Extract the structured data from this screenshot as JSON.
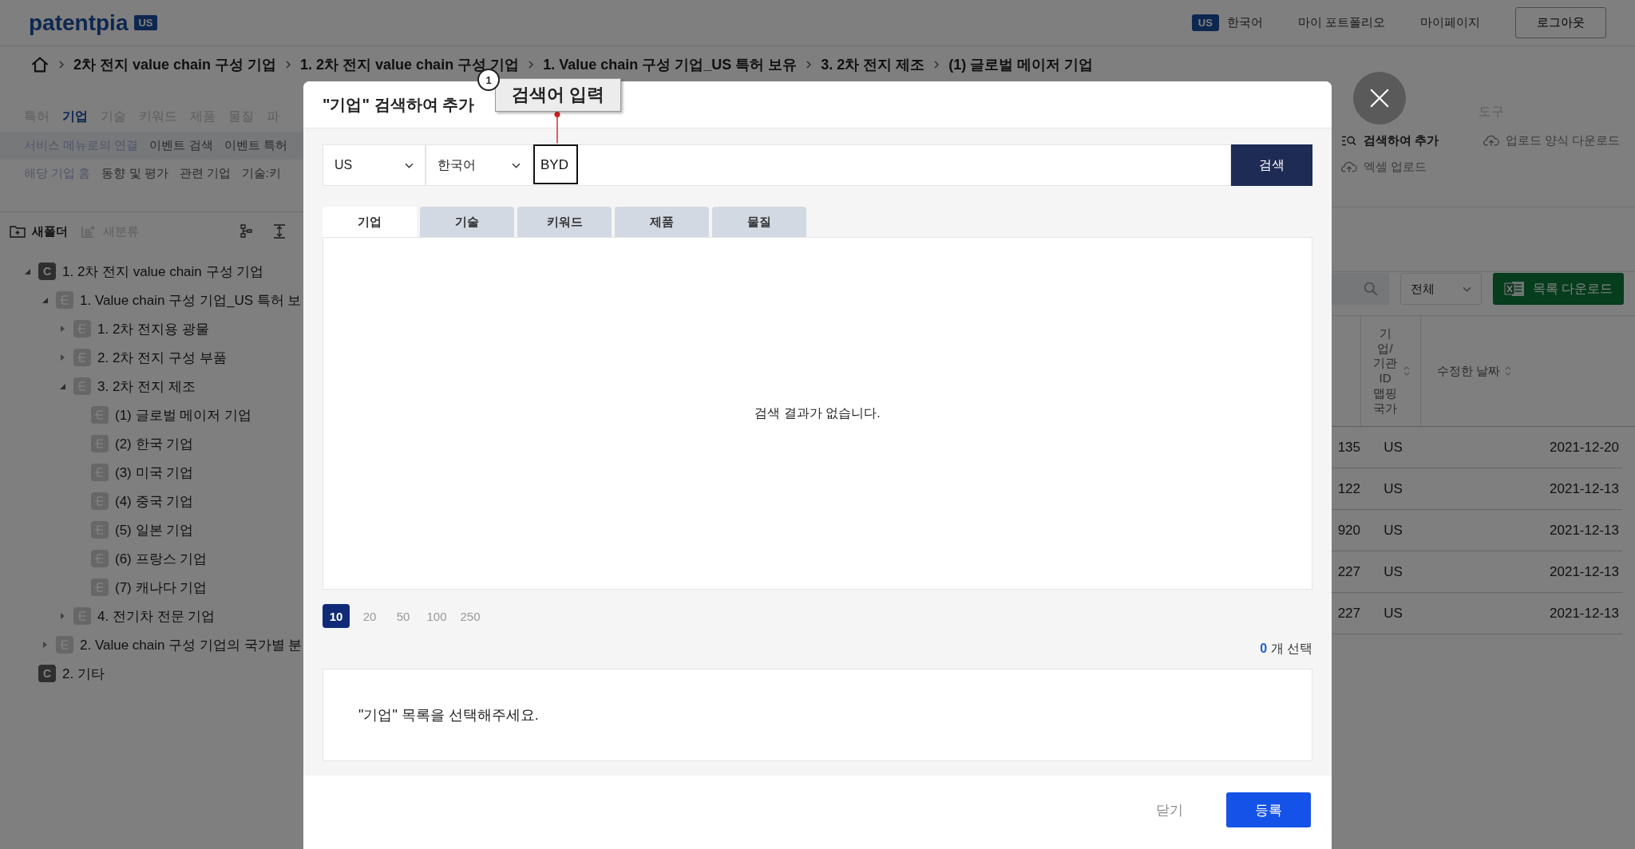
{
  "header": {
    "logo": "patentpia",
    "logo_badge": "US",
    "region_badge": "US",
    "language": "한국어",
    "links": [
      "마이 포트폴리오",
      "마이페이지"
    ],
    "logout": "로그아웃"
  },
  "breadcrumb": [
    "2차 전지 value chain 구성 기업",
    "1. 2차 전지 value chain 구성 기업",
    "1. Value chain 구성 기업_US 특허 보유",
    "3. 2차 전지 제조",
    "(1) 글로벌 메이저 기업"
  ],
  "nav_tabs": [
    {
      "label": "특허",
      "selected": false
    },
    {
      "label": "기업",
      "selected": true
    },
    {
      "label": "기술",
      "selected": false
    },
    {
      "label": "키워드",
      "selected": false
    },
    {
      "label": "제품",
      "selected": false
    },
    {
      "label": "물질",
      "selected": false
    },
    {
      "label": "파",
      "selected": false
    }
  ],
  "sub_menu_1": [
    {
      "label": "서비스 메뉴로의 연결",
      "selected": true
    },
    {
      "label": "이벤트 검색",
      "selected": false
    },
    {
      "label": "이벤트 특허",
      "selected": false
    }
  ],
  "sub_menu_2": [
    {
      "label": "해당 기업 홈",
      "selected": true
    },
    {
      "label": "동향 및 평가",
      "selected": false
    },
    {
      "label": "관련 기업",
      "selected": false
    },
    {
      "label": "기술:키",
      "selected": false
    }
  ],
  "tree_toolbar": {
    "new_folder": {
      "label": "새폴더",
      "disabled": false
    },
    "new_class": {
      "label": "새분류",
      "disabled": true
    }
  },
  "tree": [
    {
      "kind": "folder",
      "badge": "C",
      "label": "1. 2차 전지 value chain 구성 기업",
      "expanded": true,
      "children": [
        {
          "kind": "class",
          "label": "1. Value chain 구성 기업_US 특허 보",
          "expanded": true,
          "children": [
            {
              "kind": "class",
              "label": "1. 2차 전지용 광물",
              "expanded": false
            },
            {
              "kind": "class",
              "label": "2. 2차 전지 구성 부품",
              "expanded": false
            },
            {
              "kind": "class",
              "label": "3. 2차 전지 제조",
              "expanded": true,
              "children": [
                {
                  "kind": "class",
                  "label": "(1) 글로벌 메이저 기업"
                },
                {
                  "kind": "class",
                  "label": "(2) 한국 기업"
                },
                {
                  "kind": "class",
                  "label": "(3) 미국 기업"
                },
                {
                  "kind": "class",
                  "label": "(4) 중국 기업"
                },
                {
                  "kind": "class",
                  "label": "(5) 일본 기업"
                },
                {
                  "kind": "class",
                  "label": "(6) 프랑스 기업"
                },
                {
                  "kind": "class",
                  "label": "(7) 캐나다 기업"
                }
              ]
            },
            {
              "kind": "class",
              "label": "4. 전기차 전문 기업",
              "expanded": false
            }
          ]
        },
        {
          "kind": "class",
          "label": "2. Value chain 구성 기업의 국가별 분",
          "expanded": false
        }
      ]
    },
    {
      "kind": "folder",
      "badge": "C",
      "label": "2. 기타"
    }
  ],
  "tools": {
    "title": "도구",
    "items": [
      {
        "kind": "search",
        "label": "검색하여 추가",
        "selected": true
      },
      {
        "kind": "upload",
        "label": "업로드 양식 다운로드",
        "selected": false
      },
      {
        "kind": "upload",
        "label": "엑셀 업로드",
        "selected": false
      }
    ]
  },
  "list_controls": {
    "filter": "전체",
    "download": "목록 다운로드"
  },
  "table": {
    "columns": [
      "기업/기관 ID 맵핑 국가",
      "수정한 날짜"
    ],
    "rows": [
      {
        "column_1": "135",
        "country": "US",
        "modified": "2021-12-20"
      },
      {
        "column_1": "122",
        "country": "US",
        "modified": "2021-12-13"
      },
      {
        "column_1": "920",
        "country": "US",
        "modified": "2021-12-13"
      },
      {
        "column_1": "227",
        "country": "US",
        "modified": "2021-12-13"
      },
      {
        "column_1": "227",
        "country": "US",
        "modified": "2021-12-13"
      }
    ]
  },
  "dialog": {
    "title": "\"기업\" 검색하여 추가",
    "country": "US",
    "language": "한국어",
    "query": "BYD",
    "search": "검색",
    "tabs": [
      {
        "label": "기업",
        "selected": true
      },
      {
        "label": "기술",
        "selected": false
      },
      {
        "label": "키워드",
        "selected": false
      },
      {
        "label": "제품",
        "selected": false
      },
      {
        "label": "물질",
        "selected": false
      }
    ],
    "empty_message": "검색 결과가 없습니다.",
    "page_sizes": [
      {
        "label": "10",
        "selected": true
      },
      {
        "label": "20",
        "selected": false
      },
      {
        "label": "50",
        "selected": false
      },
      {
        "label": "100",
        "selected": false
      },
      {
        "label": "250",
        "selected": false
      }
    ],
    "selected_count": "0",
    "selected_suffix": "개 선택",
    "selection_hint": "\"기업\" 목록을 선택해주세요.",
    "close": "닫기",
    "submit": "등록"
  },
  "annotation": {
    "number": "1",
    "label": "검색어 입력"
  }
}
